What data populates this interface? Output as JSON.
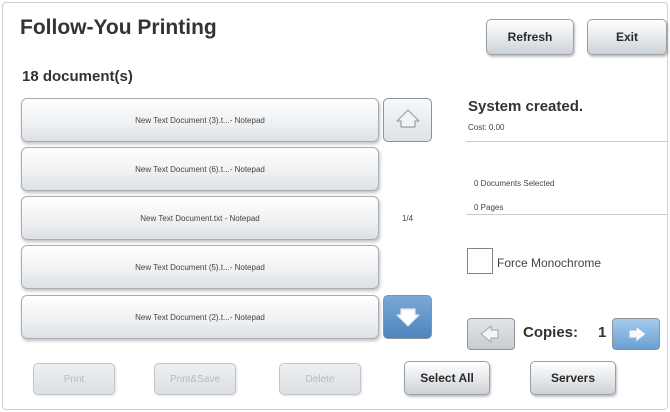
{
  "header": {
    "title": "Follow-You Printing",
    "refresh_label": "Refresh",
    "exit_label": "Exit"
  },
  "documents": {
    "count_label": "18 document(s)",
    "items": [
      "New Text Document (3).t...- Notepad",
      "New Text Document (6).t...- Notepad",
      "New Text Document.txt - Notepad",
      "New Text Document (5).t...- Notepad",
      "New Text Document (2).t...- Notepad"
    ],
    "page_indicator": "1/4"
  },
  "status": {
    "message": "System created.",
    "cost": "Cost: 0.00",
    "documents_selected": "0 Documents Selected",
    "pages": "0 Pages"
  },
  "options": {
    "force_monochrome_label": "Force Monochrome",
    "force_monochrome_checked": false
  },
  "copies": {
    "label": "Copies:",
    "value": "1"
  },
  "footer": {
    "print_label": "Print",
    "print_save_label": "Print&Save",
    "delete_label": "Delete",
    "select_all_label": "Select All",
    "servers_label": "Servers"
  },
  "colors": {
    "down_arrow_bg": "#5f94c8",
    "up_arrow_bg": "#eef0f2",
    "left_arrow_bg": "#cfd4d9",
    "right_arrow_bg": "#7fb0dc"
  },
  "icons": {
    "scroll_up": "up-arrow-icon",
    "scroll_down": "down-arrow-icon",
    "copies_decrease": "left-arrow-icon",
    "copies_increase": "right-arrow-icon"
  }
}
